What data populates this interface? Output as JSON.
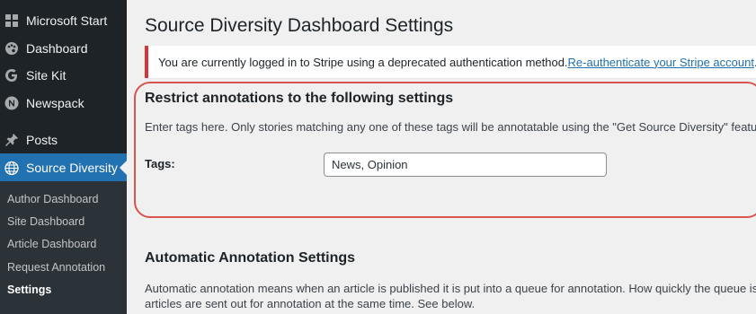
{
  "sidebar": {
    "items": [
      {
        "label": "Microsoft Start",
        "icon": "grid-icon"
      },
      {
        "label": "Dashboard",
        "icon": "palette-icon"
      },
      {
        "label": "Site Kit",
        "icon": "google-g-icon"
      },
      {
        "label": "Newspack",
        "icon": "newspack-n-icon"
      },
      {
        "label": "Posts",
        "icon": "pin-icon"
      },
      {
        "label": "Source Diversity",
        "icon": "globe-icon"
      }
    ],
    "submenu": [
      {
        "label": "Author Dashboard"
      },
      {
        "label": "Site Dashboard"
      },
      {
        "label": "Article Dashboard"
      },
      {
        "label": "Request Annotation"
      },
      {
        "label": "Settings"
      }
    ]
  },
  "page": {
    "title": "Source Diversity Dashboard Settings"
  },
  "notice": {
    "text": "You are currently logged in to Stripe using a deprecated authentication method. ",
    "link": "Re-authenticate your Stripe account",
    "suffix": "."
  },
  "restrict": {
    "title": "Restrict annotations to the following settings",
    "description": "Enter tags here. Only stories matching any one of these tags will be annotatable using the \"Get Source Diversity\" feature. Lea",
    "tags_label": "Tags:",
    "tags_value": "News, Opinion"
  },
  "automatic": {
    "title": "Automatic Annotation Settings",
    "description_line1": "Automatic annotation means when an article is published it is put into a queue for annotation. How quickly the queue is proce",
    "description_line2": "articles are sent out for annotation at the same time. See below."
  },
  "colors": {
    "sidebar_bg": "#1d2327",
    "active_bg": "#2271b1",
    "notice_border": "#d63638",
    "highlight": "#d9534f",
    "link": "#2271b1"
  }
}
